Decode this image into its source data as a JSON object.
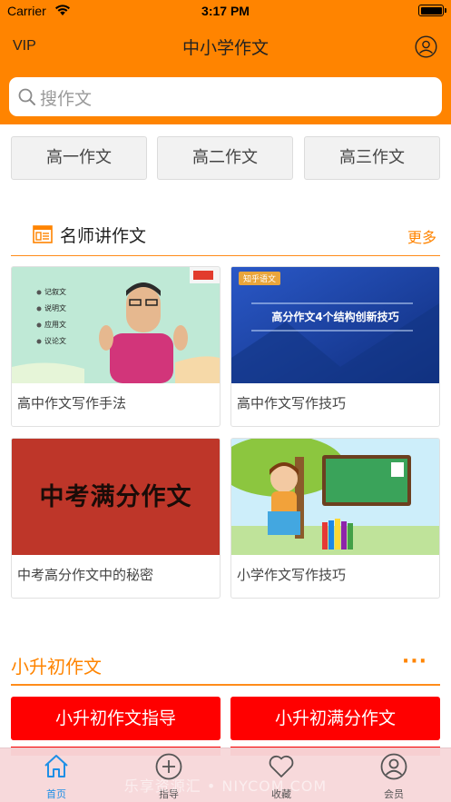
{
  "status_bar": {
    "carrier": "Carrier",
    "time": "3:17 PM"
  },
  "nav": {
    "vip": "VIP",
    "title": "中小学作文",
    "profile_icon": "user-circle-icon"
  },
  "search": {
    "placeholder": "搜作文",
    "icon": "search-icon"
  },
  "grades": [
    "高一作文",
    "高二作文",
    "高三作文"
  ],
  "teacher_section": {
    "title": "名师讲作文",
    "more": "更多",
    "icon": "article-list-icon",
    "cards": [
      {
        "label": "高中作文写作手法",
        "thumb_items": [
          "记叙文",
          "说明文",
          "应用文",
          "议论文"
        ]
      },
      {
        "label": "高中作文写作技巧",
        "thumb_badge": "知乎语文",
        "thumb_text": "高分作文4个结构创新技巧"
      },
      {
        "label": "中考高分作文中的秘密",
        "thumb_text": "中考满分作文"
      },
      {
        "label": "小学作文写作技巧"
      }
    ]
  },
  "xsc_section": {
    "title": "小升初作文",
    "more": "···",
    "buttons": [
      "小升初作文指导",
      "小升初满分作文"
    ]
  },
  "tabbar": {
    "tabs": [
      {
        "label": "首页",
        "icon": "home-icon",
        "active": true
      },
      {
        "label": "指导",
        "icon": "plus-circle-icon",
        "active": false
      },
      {
        "label": "收藏",
        "icon": "heart-icon",
        "active": false
      },
      {
        "label": "会员",
        "icon": "user-circle-icon",
        "active": false
      }
    ],
    "watermark": "乐享资源汇 • NIYCOM.COM"
  },
  "colors": {
    "primary": "#ff8400",
    "button_red": "#ff0000",
    "tab_active": "#1e8fe6"
  }
}
